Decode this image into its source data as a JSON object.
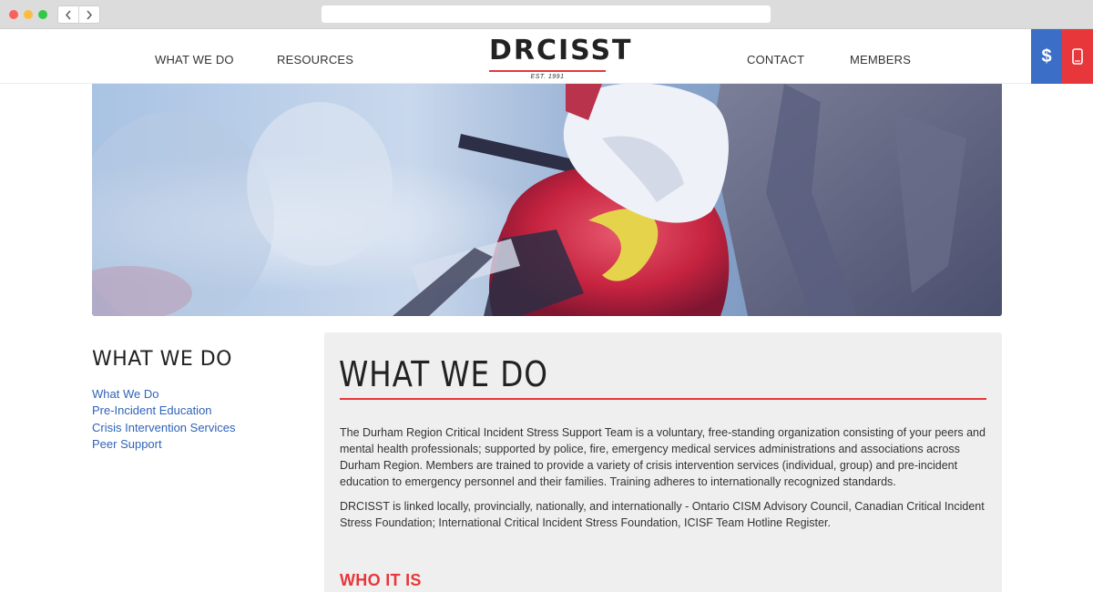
{
  "colors": {
    "accent_red": "#e8373a",
    "accent_blue": "#3a6ec7",
    "link_blue": "#2f63b9",
    "content_bg": "#efefef"
  },
  "browser": {
    "back_icon": "chevron-left-icon",
    "forward_icon": "chevron-right-icon"
  },
  "nav": {
    "what_we_do": "WHAT WE DO",
    "resources": "RESOURCES",
    "contact": "CONTACT",
    "members": "MEMBERS"
  },
  "logo": {
    "text": "DRCISST",
    "est": "EST. 1991"
  },
  "side_buttons": {
    "donate_symbol": "$",
    "donate_icon": "dollar-icon",
    "phone_icon": "mobile-phone-icon"
  },
  "sidebar": {
    "title": "WHAT WE DO",
    "links": [
      {
        "label": "What We Do"
      },
      {
        "label": "Pre-Incident Education"
      },
      {
        "label": "Crisis Intervention Services"
      },
      {
        "label": "Peer Support"
      }
    ]
  },
  "main": {
    "title": "WHAT WE DO",
    "paragraphs": [
      "The Durham Region Critical Incident Stress Support Team is a voluntary, free-standing organization consisting of your peers and mental health professionals; supported by police, fire, emergency medical services administrations and associations across Durham Region. Members are trained to provide a variety of crisis intervention services (individual, group) and pre-incident education to emergency personnel and their families. Training adheres to internationally recognized standards.",
      "DRCISST is linked locally, provincially, nationally, and internationally - Ontario CISM Advisory Council, Canadian Critical Incident Stress Foundation; International Critical Incident Stress Foundation, ICISF Team Hotline Register."
    ],
    "subheading": "WHO IT IS"
  }
}
